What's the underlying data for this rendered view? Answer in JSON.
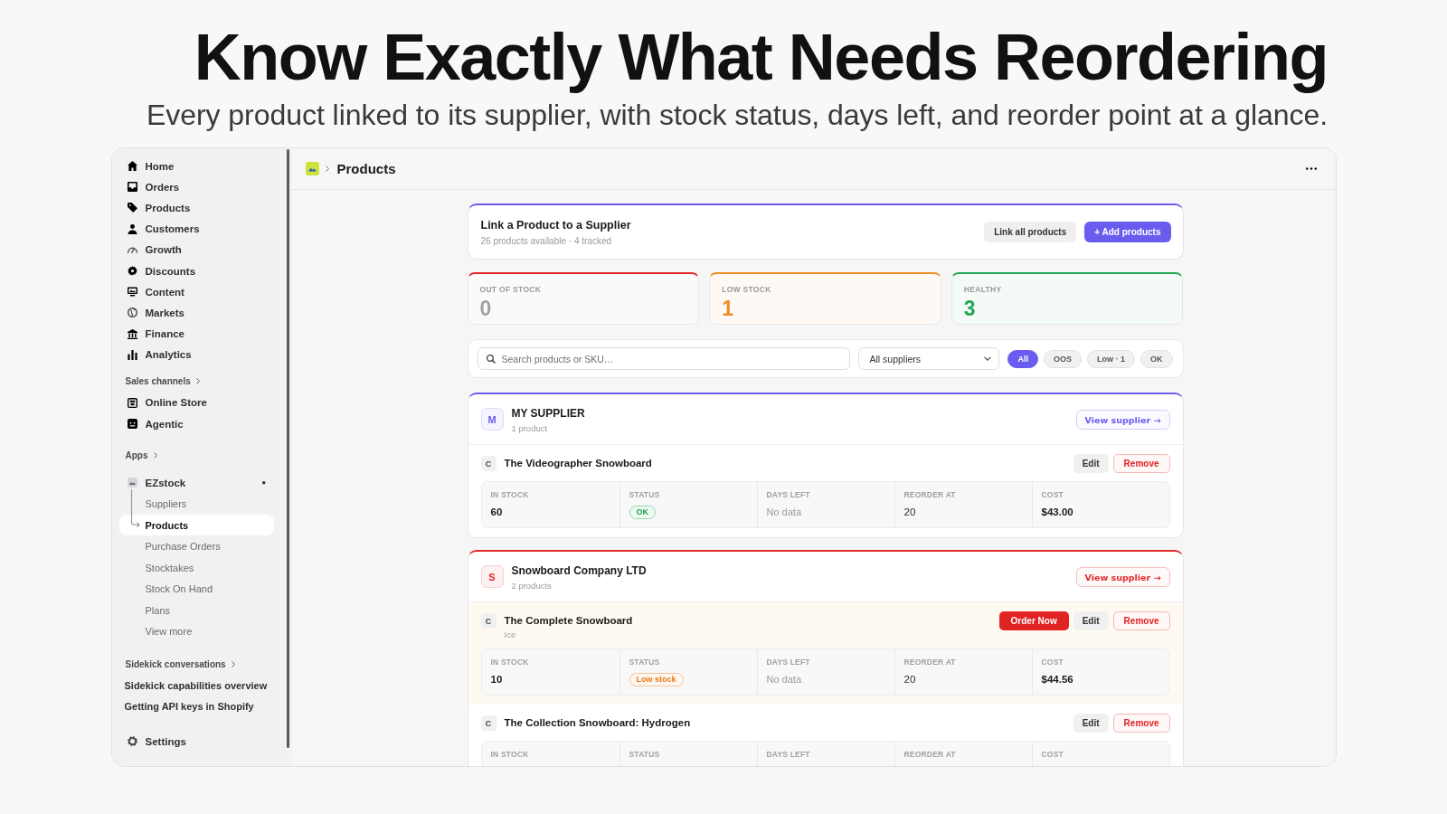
{
  "headline": {
    "title": "Know Exactly What Needs Reordering",
    "subtitle": "Every product linked to its supplier, with stock status, days left, and reorder point at a glance."
  },
  "sidebar": {
    "nav": [
      {
        "label": "Home",
        "selected": false
      },
      {
        "label": "Orders",
        "selected": false
      },
      {
        "label": "Products",
        "selected": false
      },
      {
        "label": "Customers",
        "selected": false
      },
      {
        "label": "Growth",
        "selected": false
      },
      {
        "label": "Discounts",
        "selected": false
      },
      {
        "label": "Content",
        "selected": false
      },
      {
        "label": "Markets",
        "selected": false
      },
      {
        "label": "Finance",
        "selected": false
      },
      {
        "label": "Analytics",
        "selected": false
      }
    ],
    "sales_channels": {
      "heading": "Sales channels",
      "items": [
        {
          "label": "Online Store",
          "selected": false
        },
        {
          "label": "Agentic",
          "selected": false
        }
      ]
    },
    "apps": {
      "heading": "Apps",
      "app": {
        "name": "EZstock",
        "children": [
          {
            "label": "Suppliers",
            "selected": false
          },
          {
            "label": "Products",
            "selected": true
          },
          {
            "label": "Purchase Orders",
            "selected": false
          },
          {
            "label": "Stocktakes",
            "selected": false
          },
          {
            "label": "Stock On Hand",
            "selected": false
          },
          {
            "label": "Plans",
            "selected": false
          },
          {
            "label": "View more",
            "selected": false
          }
        ]
      }
    },
    "sidekick": {
      "heading": "Sidekick conversations",
      "items": [
        {
          "label": "Sidekick capabilities overview",
          "selected": false
        },
        {
          "label": "Getting API keys in Shopify",
          "selected": false
        }
      ]
    },
    "settings": {
      "label": "Settings",
      "selected": false
    }
  },
  "page_header": {
    "title": "Products"
  },
  "link_card": {
    "title": "Link a Product to a Supplier",
    "subtitle": "26 products available · 4 tracked",
    "buttons": [
      {
        "label": "Link all products",
        "kind": "secondary"
      },
      {
        "label": "+ Add products",
        "kind": "primary"
      }
    ]
  },
  "stats": [
    {
      "label": "OUT OF STOCK",
      "value": "0",
      "color": "#e5282a",
      "muted": true
    },
    {
      "label": "LOW STOCK",
      "value": "1",
      "color": "#f08c24",
      "muted": false
    },
    {
      "label": "HEALTHY",
      "value": "3",
      "color": "#22a855",
      "muted": false
    }
  ],
  "filters": {
    "search": {
      "placeholder": "Search products or SKU…"
    },
    "supplier_select": {
      "value": "All suppliers"
    },
    "chips": [
      {
        "label": "All",
        "selected": true
      },
      {
        "label": "OOS",
        "selected": false
      },
      {
        "label": "Low · 1",
        "selected": false
      },
      {
        "label": "OK",
        "selected": false
      }
    ]
  },
  "suppliers": [
    {
      "initial": "M",
      "name": "MY SUPPLIER",
      "count": "1 product",
      "color": "#6b5cf0",
      "view_label": "View supplier →",
      "products": [
        {
          "initial": "C",
          "name": "The Videographer Snowboard",
          "highlighted": false,
          "actions": [
            {
              "label": "Edit",
              "kind": "neutral"
            },
            {
              "label": "Remove",
              "kind": "danger"
            }
          ],
          "stats": [
            {
              "label": "IN STOCK",
              "value": "60",
              "kind": "strong"
            },
            {
              "label": "STATUS",
              "value": "OK",
              "kind": "badge",
              "color": "#16a34a"
            },
            {
              "label": "DAYS LEFT",
              "value": "No data",
              "kind": "muted"
            },
            {
              "label": "REORDER AT",
              "value": "20",
              "kind": "plain"
            },
            {
              "label": "COST",
              "value": "$43.00",
              "kind": "strong"
            }
          ]
        }
      ]
    },
    {
      "initial": "S",
      "name": "Snowboard Company LTD",
      "count": "2 products",
      "color": "#e12a2a",
      "view_label": "View supplier →",
      "products": [
        {
          "initial": "C",
          "name": "The Complete Snowboard",
          "note": "Ice",
          "highlighted": true,
          "actions": [
            {
              "label": "Order Now",
              "kind": "order"
            },
            {
              "label": "Edit",
              "kind": "neutral"
            },
            {
              "label": "Remove",
              "kind": "danger"
            }
          ],
          "stats": [
            {
              "label": "IN STOCK",
              "value": "10",
              "kind": "strong"
            },
            {
              "label": "STATUS",
              "value": "Low stock",
              "kind": "badge",
              "color": "#ea7a10"
            },
            {
              "label": "DAYS LEFT",
              "value": "No data",
              "kind": "muted"
            },
            {
              "label": "REORDER AT",
              "value": "20",
              "kind": "plain"
            },
            {
              "label": "COST",
              "value": "$44.56",
              "kind": "strong"
            }
          ]
        },
        {
          "initial": "C",
          "name": "The Collection Snowboard: Hydrogen",
          "highlighted": false,
          "actions": [
            {
              "label": "Edit",
              "kind": "neutral"
            },
            {
              "label": "Remove",
              "kind": "danger"
            }
          ],
          "stats": [
            {
              "label": "IN STOCK"
            },
            {
              "label": "STATUS"
            },
            {
              "label": "DAYS LEFT"
            },
            {
              "label": "REORDER AT"
            },
            {
              "label": "COST"
            }
          ]
        }
      ]
    }
  ]
}
